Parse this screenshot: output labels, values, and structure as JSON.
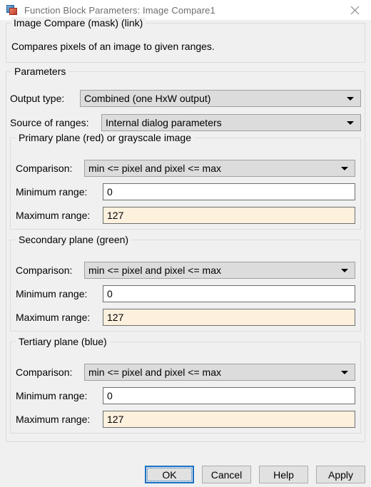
{
  "window": {
    "title": "Function Block Parameters: Image Compare1",
    "icon": "simulink-block-icon",
    "close_label": "close-icon"
  },
  "description": {
    "heading": "Image Compare (mask) (link)",
    "body": "Compares pixels of an image to given ranges."
  },
  "parameters": {
    "legend": "Parameters",
    "output_type": {
      "label": "Output type:",
      "value": "Combined (one HxW output)"
    },
    "source_of_ranges": {
      "label": "Source of ranges:",
      "value": "Internal dialog parameters"
    }
  },
  "planes": [
    {
      "legend": "Primary plane (red) or grayscale image",
      "comparison": {
        "label": "Comparison:",
        "value": "min <= pixel and pixel <= max"
      },
      "minimum": {
        "label": "Minimum range:",
        "value": "0",
        "modified": false
      },
      "maximum": {
        "label": "Maximum range:",
        "value": "127",
        "modified": true
      }
    },
    {
      "legend": "Secondary plane (green)",
      "comparison": {
        "label": "Comparison:",
        "value": "min <= pixel and pixel <= max"
      },
      "minimum": {
        "label": "Minimum range:",
        "value": "0",
        "modified": false
      },
      "maximum": {
        "label": "Maximum range:",
        "value": "127",
        "modified": true
      }
    },
    {
      "legend": "Tertiary plane (blue)",
      "comparison": {
        "label": "Comparison:",
        "value": "min <= pixel and pixel <= max"
      },
      "minimum": {
        "label": "Minimum range:",
        "value": "0",
        "modified": false
      },
      "maximum": {
        "label": "Maximum range:",
        "value": "127",
        "modified": true
      }
    }
  ],
  "buttons": {
    "ok": "OK",
    "cancel": "Cancel",
    "help": "Help",
    "apply": "Apply"
  },
  "colors": {
    "dialog_background": "#f0f0f0",
    "titlebar_background": "#ffffff",
    "modified_field": "#fdf1de",
    "default_button_border": "#1a72c6",
    "combo_background": "#dcdcdc"
  }
}
